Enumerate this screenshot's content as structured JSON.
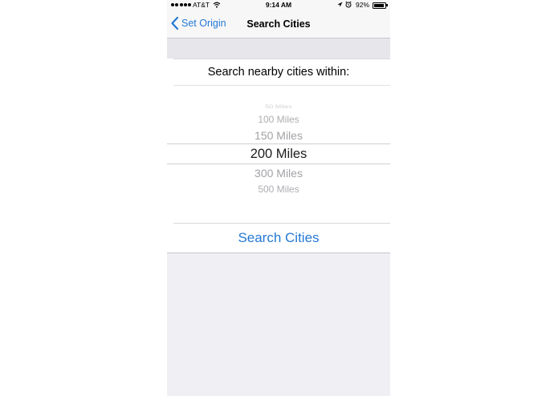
{
  "status_bar": {
    "carrier": "AT&T",
    "time": "9:14 AM",
    "battery_percent": "92%",
    "battery_level": 0.92,
    "icons": [
      "signal-icon",
      "wifi-icon",
      "location-icon",
      "alarm-icon",
      "battery-icon"
    ]
  },
  "nav": {
    "back_label": "Set Origin",
    "title": "Search Cities"
  },
  "prompt": "Search nearby cities within:",
  "picker": {
    "options": [
      "50 Miles",
      "100 Miles",
      "150 Miles",
      "200 Miles",
      "300 Miles",
      "500 Miles"
    ],
    "selected": "200 Miles"
  },
  "search_button_label": "Search Cities",
  "colors": {
    "accent": "#2479d6",
    "background": "#efeff4"
  }
}
